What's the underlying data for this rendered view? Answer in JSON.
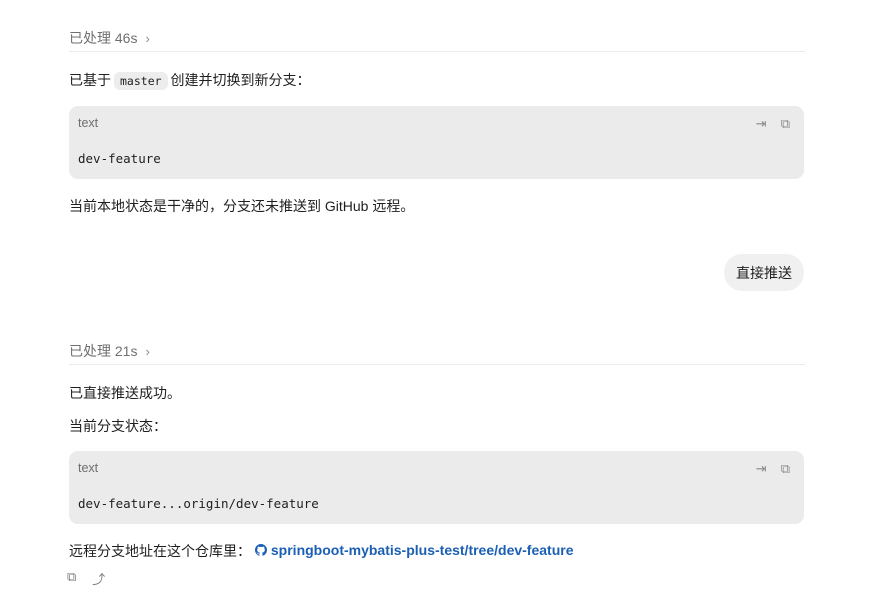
{
  "turn1": {
    "processed_label": "已处理 46s",
    "chevron": "chevron-right-icon",
    "intro_prefix": "已基于",
    "intro_code": "master",
    "intro_suffix": "创建并切换到新分支：",
    "code_block": {
      "lang": "text",
      "code": "dev-feature"
    },
    "status_text": "当前本地状态是干净的，分支还未推送到 GitHub 远程。"
  },
  "user_message": {
    "text": "直接推送"
  },
  "turn2": {
    "processed_label": "已处理 21s",
    "line1": "已直接推送成功。",
    "line2": "当前分支状态：",
    "code_block": {
      "lang": "text",
      "code": "dev-feature...origin/dev-feature"
    },
    "remote_prefix": "远程分支地址在这个仓库里：",
    "remote_link": "springboot-mybatis-plus-test/tree/dev-feature"
  },
  "icons": {
    "wrap": "wrap-icon",
    "copy": "copy-icon",
    "github": "github-icon",
    "share": "share-icon"
  },
  "colors": {
    "link": "#1a5fb4",
    "code_bg": "#ebebeb",
    "bubble_bg": "#f0f0f0"
  }
}
